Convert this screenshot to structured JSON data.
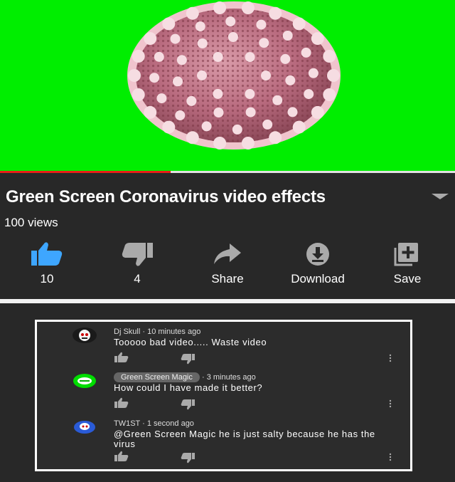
{
  "video": {
    "progress_fraction": 0.375,
    "progress_color": "#e62117",
    "background_color": "#00ee00"
  },
  "info": {
    "title": "Green Screen Coronavirus video effects",
    "views": "100 views"
  },
  "actions": [
    {
      "id": "like",
      "label": "10",
      "icon": "thumbs-up-icon",
      "color": "#3ea6ff"
    },
    {
      "id": "dislike",
      "label": "4",
      "icon": "thumbs-down-icon",
      "color": "#aaaaaa"
    },
    {
      "id": "share",
      "label": "Share",
      "icon": "share-icon",
      "color": "#aaaaaa"
    },
    {
      "id": "download",
      "label": "Download",
      "icon": "download-icon",
      "color": "#aaaaaa"
    },
    {
      "id": "save",
      "label": "Save",
      "icon": "playlist-add-icon",
      "color": "#aaaaaa"
    }
  ],
  "comments": [
    {
      "author": "Dj Skull",
      "time": "10 minutes ago",
      "text": "Tooooo bad video..... Waste video",
      "author_highlighted": false
    },
    {
      "author": "Green Screen Magic",
      "time": "3 minutes ago",
      "text": "How could I have made it better?",
      "author_highlighted": true
    },
    {
      "author": "TW1ST",
      "time": "1 second ago",
      "text": "@Green Screen Magic he is just salty because he has the virus",
      "author_highlighted": false
    }
  ]
}
